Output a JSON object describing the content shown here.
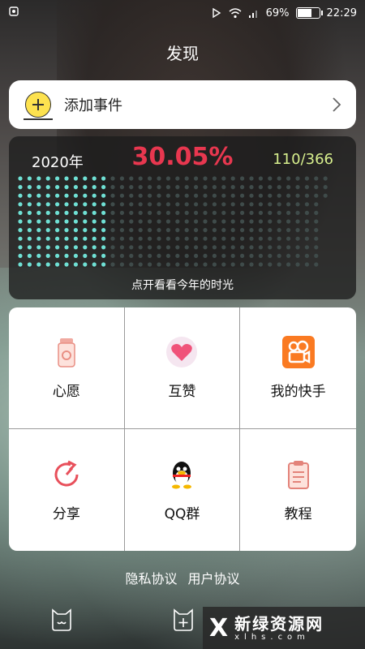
{
  "status_bar": {
    "battery_pct": "69%",
    "battery_level": 0.69,
    "time": "22:29"
  },
  "header": {
    "title": "发现"
  },
  "add_event": {
    "label": "添加事件"
  },
  "year_progress": {
    "year": "2020年",
    "percent": "30.05%",
    "days": "110/366",
    "days_elapsed": 110,
    "days_total": 366,
    "caption": "点开看看今年的时光",
    "colors": {
      "filled": "#6fe0d4",
      "empty": "#3f4b4a",
      "percent": "#e8374f",
      "days": "#d7ef8d"
    }
  },
  "grid": {
    "items": [
      {
        "label": "心愿",
        "icon": "wish-jar-icon"
      },
      {
        "label": "互赞",
        "icon": "heart-icon"
      },
      {
        "label": "我的快手",
        "icon": "kuaishou-icon"
      },
      {
        "label": "分享",
        "icon": "share-icon"
      },
      {
        "label": "QQ群",
        "icon": "qq-penguin-icon"
      },
      {
        "label": "教程",
        "icon": "clipboard-icon"
      }
    ]
  },
  "footer_links": {
    "privacy": "隐私协议",
    "user": "用户协议"
  },
  "watermark": {
    "logo": "X",
    "title": "新绿资源网",
    "url": "xlhs.com"
  }
}
